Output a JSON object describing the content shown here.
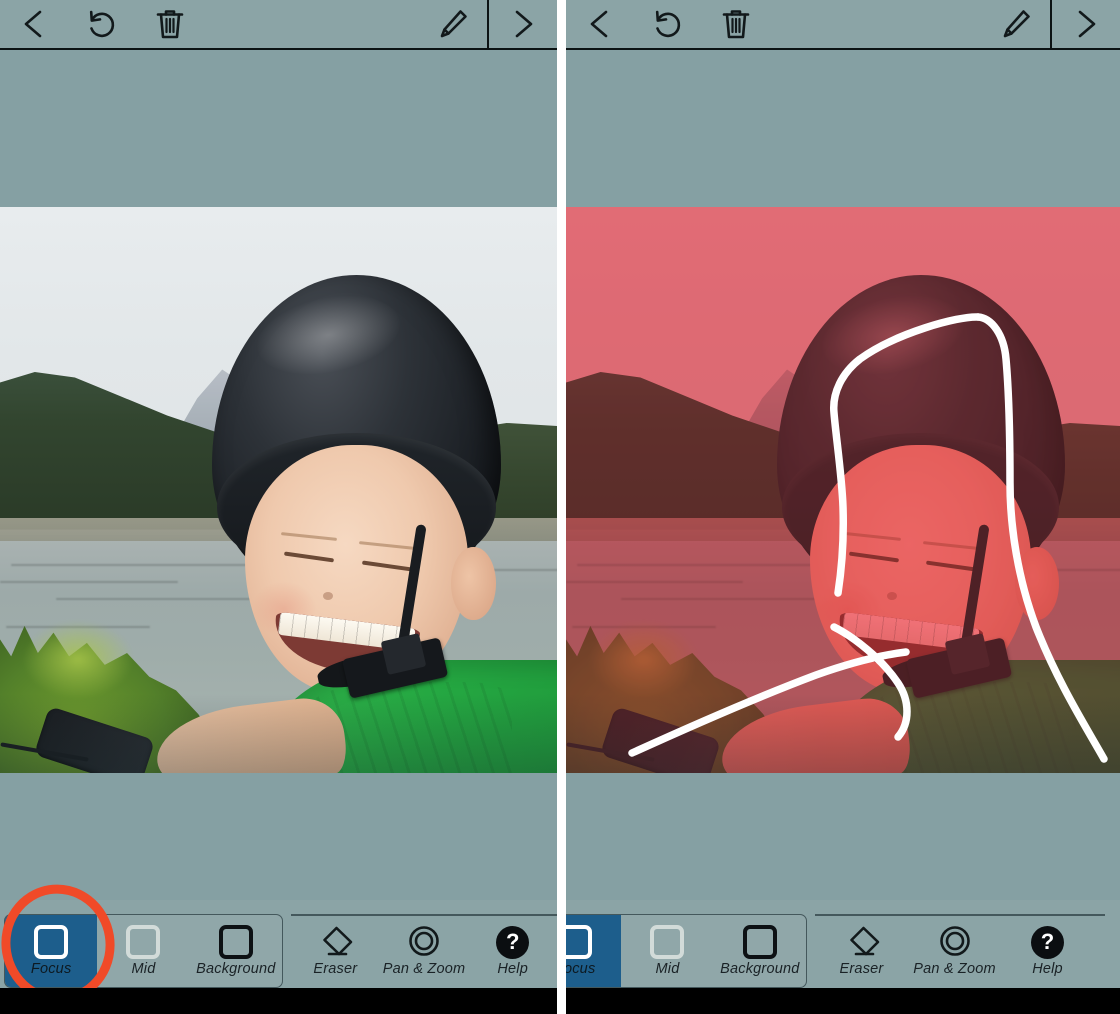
{
  "app": {
    "name": "photo-focus-editor",
    "background_color": "#85a0a3",
    "toolbar_color": "#8ba4a6",
    "selected_color": "#1d5e8c",
    "mask_overlay_color": "#f4717a",
    "brush_color": "#ffffff",
    "annotation_color": "#f04a28"
  },
  "top_toolbar": {
    "back_icon": "chevron-left-icon",
    "undo_icon": "undo-icon",
    "delete_icon": "trash-icon",
    "edit_icon": "pencil-icon",
    "next_icon": "chevron-right-icon"
  },
  "bottom_toolbar": {
    "mask_tools": [
      {
        "label": "Focus",
        "icon": "focus-square-icon",
        "selected": true
      },
      {
        "label": "Mid",
        "icon": "mid-square-icon",
        "selected": false
      },
      {
        "label": "Background",
        "icon": "background-square-icon",
        "selected": false
      }
    ],
    "utility_tools": [
      {
        "label": "Eraser",
        "icon": "eraser-icon"
      },
      {
        "label": "Pan & Zoom",
        "icon": "pan-zoom-icon"
      },
      {
        "label": "Help",
        "icon": "help-icon",
        "glyph": "?"
      }
    ]
  },
  "panels": [
    {
      "id": "before",
      "state": "unmasked",
      "mask_overlay_visible": false,
      "brush_strokes_visible": false,
      "annotation_visible": true,
      "annotation_target": "Focus"
    },
    {
      "id": "after",
      "state": "masked",
      "mask_overlay_visible": true,
      "brush_strokes_visible": true,
      "annotation_visible": false,
      "annotation_target": ""
    }
  ],
  "photo": {
    "description": "boy in bike helmet and green t-shirt laughing by a lake",
    "subject": "boy-with-helmet",
    "scene_elements": [
      "sky",
      "mountains",
      "forest-hills",
      "lake",
      "grass",
      "bicycle-handlebar"
    ]
  }
}
